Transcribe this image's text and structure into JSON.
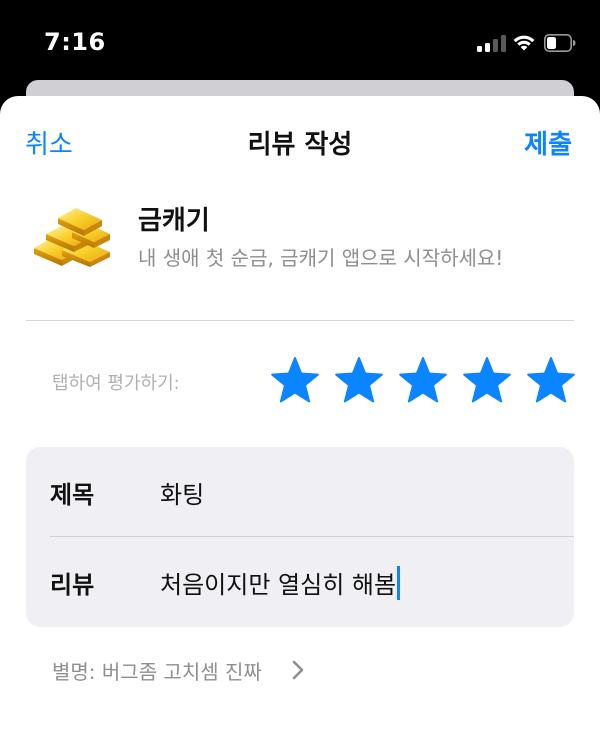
{
  "status_bar": {
    "time": "7:16"
  },
  "nav": {
    "cancel": "취소",
    "title": "리뷰 작성",
    "submit": "제출"
  },
  "app": {
    "name": "금캐기",
    "subtitle": "내 생애 첫 순금, 금캐기 앱으로 시작하세요!",
    "icon": "gold-bars-icon"
  },
  "rating": {
    "label": "탭하여 평가하기:",
    "stars_filled": 5,
    "stars_total": 5,
    "star_color": "#0a84ff"
  },
  "form": {
    "title_label": "제목",
    "title_value": "화팅",
    "review_label": "리뷰",
    "review_value": "처음이지만 열심히 해봄"
  },
  "nickname": {
    "text": "별명: 버그좀 고치셈 진짜"
  },
  "colors": {
    "accent": "#0a84ff",
    "secondary_text": "#8e8e93"
  }
}
